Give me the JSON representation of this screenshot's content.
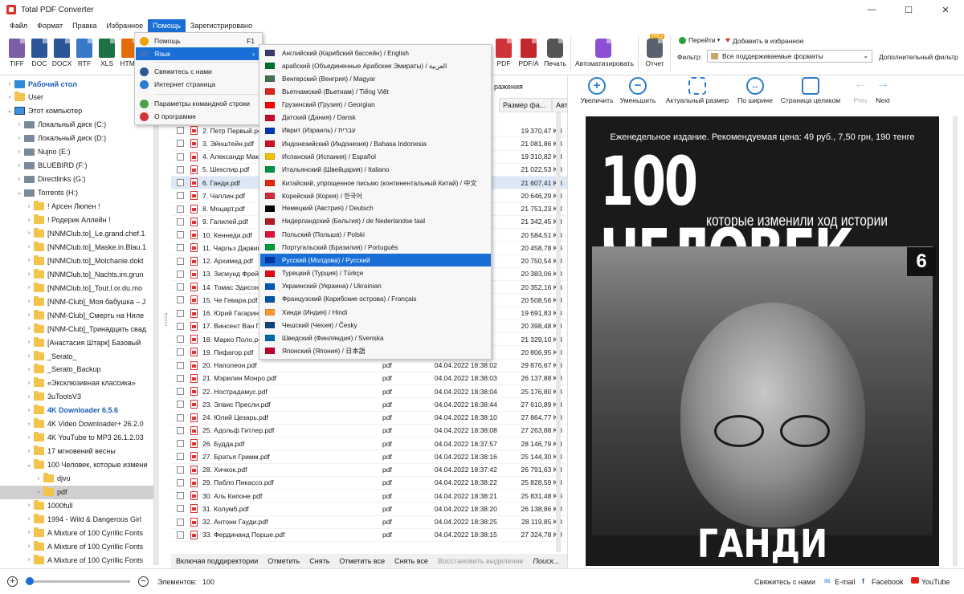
{
  "window": {
    "title": "Total PDF Converter"
  },
  "menu": [
    "Файл",
    "Формат",
    "Правка",
    "Избранное",
    "Помощь",
    "Зарегистрировано"
  ],
  "toolbar": {
    "formats": [
      {
        "label": "TIFF",
        "color": "#7b5ea7"
      },
      {
        "label": "DOC",
        "color": "#2b5797"
      },
      {
        "label": "DOCX",
        "color": "#2b5797"
      },
      {
        "label": "RTF",
        "color": "#3a79c8"
      },
      {
        "label": "XLS",
        "color": "#1e7145"
      },
      {
        "label": "HTML",
        "color": "#e36c09"
      },
      {
        "label": "PDF",
        "color": "#d13438"
      },
      {
        "label": "PDF/A",
        "color": "#c1272d"
      }
    ],
    "print": "Печать",
    "automate": "Автоматизировать",
    "report": "Отчет",
    "pro_badge": "PRO",
    "goto": "Перейти",
    "add_fav": "Добавить в избранное",
    "filter_label": "Фильтр:",
    "filter_value": "Все поддерживаемые форматы",
    "advanced_filter": "Дополнительный фильтр"
  },
  "help_menu": [
    {
      "label": "Помощь",
      "shortcut": "F1",
      "icon": "help-icon",
      "color": "#f0a30a"
    },
    {
      "label": "Язык",
      "icon": "language-flag-icon",
      "color": "#3a6fc4"
    },
    {
      "label": "Свяжитесь с нами",
      "icon": "contact-icon",
      "color": "#2b5797"
    },
    {
      "label": "Интернет страница",
      "icon": "web-icon",
      "color": "#2b7bd0"
    },
    {
      "label": "Параметры командной строки",
      "icon": "command-line-icon",
      "color": "#4aa34a"
    },
    {
      "label": "О программе",
      "icon": "about-icon",
      "color": "#d13438"
    }
  ],
  "languages": [
    {
      "label": "Английский (Карибский бассейн) / English",
      "flag": "#3c3b6e"
    },
    {
      "label": "арабский (Объединенные Арабские Эмираты) / العربية",
      "flag": "#00732f"
    },
    {
      "label": "Венгерский (Венгрия) / Magyar",
      "flag": "#477050"
    },
    {
      "label": "Вьетнамский (Вьетнам) / Tiếng Việt",
      "flag": "#da251d"
    },
    {
      "label": "Грузинский (Грузия) / Georgian",
      "flag": "#ff0000"
    },
    {
      "label": "Датский (Дания) / Dansk",
      "flag": "#c60c30"
    },
    {
      "label": "Иврит (Израиль) / עברית",
      "flag": "#0038b8"
    },
    {
      "label": "Индонезийский (Индонезия) / Bahasa Indonesia",
      "flag": "#ce1126"
    },
    {
      "label": "Испанский (Испания) / Español",
      "flag": "#f1bf00"
    },
    {
      "label": "Итальянский (Швейцария) / Italiano",
      "flag": "#009246"
    },
    {
      "label": "Китайский, упрощенное письмо (континентальный Китай) / 中文",
      "flag": "#de2910"
    },
    {
      "label": "Корейский (Корея) / 한국어",
      "flag": "#cd2e3a"
    },
    {
      "label": "Немецкий (Австрия) / Deutsch",
      "flag": "#000000"
    },
    {
      "label": "Нидерландский (Бельгия) / de Nederlandse taal",
      "flag": "#ae1c28"
    },
    {
      "label": "Польский (Польша) / Polski",
      "flag": "#dc143c"
    },
    {
      "label": "Португальский (Бразилия) / Português",
      "flag": "#009c3b"
    },
    {
      "label": "Русский (Молдова) / Русский",
      "flag": "#0039a6"
    },
    {
      "label": "Турецкий (Турция) / Türkçe",
      "flag": "#e30a17"
    },
    {
      "label": "Украинский (Украина) / Ukrainian",
      "flag": "#0057b7"
    },
    {
      "label": "Французский (Карибские острова) / Français",
      "flag": "#0055a4"
    },
    {
      "label": "Хинди (Индия) / Hindi",
      "flag": "#ff9933"
    },
    {
      "label": "Чешский (Чехия) / Česky",
      "flag": "#11457e"
    },
    {
      "label": "Шведский (Финляндия) / Svenska",
      "flag": "#006aa7"
    },
    {
      "label": "Японский (Япония) / 日本語",
      "flag": "#bc002d"
    }
  ],
  "selected_language_index": 16,
  "tree": [
    {
      "label": "Рабочий стол",
      "icon": "desktop",
      "indent": 0,
      "arrow": "›",
      "bold": true
    },
    {
      "label": "User",
      "icon": "folder",
      "indent": 0,
      "arrow": "›"
    },
    {
      "label": "Этот компьютер",
      "icon": "pc",
      "indent": 0,
      "arrow": "⌄"
    },
    {
      "label": "Локальный диск (C:)",
      "icon": "drive",
      "indent": 1,
      "arrow": "›"
    },
    {
      "label": "Локальный диск (D:)",
      "icon": "drive",
      "indent": 1,
      "arrow": "›"
    },
    {
      "label": "Nujno (E:)",
      "icon": "drive",
      "indent": 1,
      "arrow": "›"
    },
    {
      "label": "BLUEBIRD (F:)",
      "icon": "drive",
      "indent": 1,
      "arrow": "›"
    },
    {
      "label": "Directlinks (G:)",
      "icon": "drive",
      "indent": 1,
      "arrow": "›"
    },
    {
      "label": "Torrents (H:)",
      "icon": "drive",
      "indent": 1,
      "arrow": "⌄"
    },
    {
      "label": "! Арсен Люпен !",
      "icon": "folder",
      "indent": 2,
      "arrow": "›"
    },
    {
      "label": "! Родерик Аллейн !",
      "icon": "folder",
      "indent": 2,
      "arrow": "›"
    },
    {
      "label": "[NNMClub.to]_Le.grand.chef.1",
      "icon": "folder",
      "indent": 2,
      "arrow": "›"
    },
    {
      "label": "[NNMClub.to]_Maske.in.Blau.1",
      "icon": "folder",
      "indent": 2,
      "arrow": "›"
    },
    {
      "label": "[NNMClub.to]_Molchanie.dokt",
      "icon": "folder",
      "indent": 2,
      "arrow": "›"
    },
    {
      "label": "[NNMClub.to]_Nachts.im.grun",
      "icon": "folder",
      "indent": 2,
      "arrow": "›"
    },
    {
      "label": "[NNMClub.to]_Tout.l.or.du.mo",
      "icon": "folder",
      "indent": 2,
      "arrow": "›"
    },
    {
      "label": "[NNM-Club]_Моя бабушка – J",
      "icon": "folder",
      "indent": 2,
      "arrow": "›"
    },
    {
      "label": "[NNM-Club]_Смерть на Ниле",
      "icon": "folder",
      "indent": 2,
      "arrow": "›"
    },
    {
      "label": "[NNM-Club]_Тринадцать свад",
      "icon": "folder",
      "indent": 2,
      "arrow": "›"
    },
    {
      "label": "[Анастасия Штарк] Базовый",
      "icon": "folder",
      "indent": 2,
      "arrow": "›"
    },
    {
      "label": "_Serato_",
      "icon": "folder",
      "indent": 2,
      "arrow": "›"
    },
    {
      "label": "_Serato_Backup",
      "icon": "folder",
      "indent": 2,
      "arrow": "›"
    },
    {
      "label": "«Эксклюзивная классика»",
      "icon": "folder",
      "indent": 2,
      "arrow": "›"
    },
    {
      "label": "3uToolsV3",
      "icon": "folder",
      "indent": 2,
      "arrow": "›"
    },
    {
      "label": "4K Downloader 6.5.6",
      "icon": "folder",
      "indent": 2,
      "arrow": "›",
      "bold": true
    },
    {
      "label": "4K Video Downloader+ 26.2.0",
      "icon": "folder",
      "indent": 2,
      "arrow": "›"
    },
    {
      "label": "4K YouTube to MP3 26.1.2.03",
      "icon": "folder",
      "indent": 2,
      "arrow": "›"
    },
    {
      "label": "17 мгновений весны",
      "icon": "folder",
      "indent": 2,
      "arrow": "›"
    },
    {
      "label": "100 Человек, которые измени",
      "icon": "folder",
      "indent": 2,
      "arrow": "⌄"
    },
    {
      "label": "djvu",
      "icon": "folder",
      "indent": 3,
      "arrow": "›"
    },
    {
      "label": "pdf",
      "icon": "folder",
      "indent": 3,
      "arrow": "›",
      "selected": true
    },
    {
      "label": "1000full",
      "icon": "folder",
      "indent": 2,
      "arrow": "›"
    },
    {
      "label": "1994 - Wild & Dangerous Girl",
      "icon": "folder",
      "indent": 2,
      "arrow": "›"
    },
    {
      "label": "A Mixture of 100 Cyrillic Fonts",
      "icon": "folder",
      "indent": 2,
      "arrow": "›"
    },
    {
      "label": "A Mixture of 100 Cyrillic Fonts",
      "icon": "folder",
      "indent": 2,
      "arrow": "›"
    },
    {
      "label": "A Mixture of 100 Cyrillic Fonts",
      "icon": "folder",
      "indent": 2,
      "arrow": "›"
    }
  ],
  "filelist": {
    "header_tab_partial": "ражения",
    "columns": {
      "size": "Размер фа...",
      "author": "Авт"
    },
    "rows": [
      {
        "name": "2. Петр Первый.pdf",
        "type": "",
        "date": "",
        "size": "19 370,47 KB"
      },
      {
        "name": "3. Эйнштейн.pdf",
        "type": "",
        "date": "",
        "size": "21 081,86 KB"
      },
      {
        "name": "4. Александр Маке",
        "type": "",
        "date": "",
        "size": "19 310,82 KB"
      },
      {
        "name": "5. Шекспир.pdf",
        "type": "",
        "date": "",
        "size": "21 022,53 KB"
      },
      {
        "name": "6. Ганди.pdf",
        "type": "",
        "date": "",
        "size": "21 607,41 KB",
        "selected": true
      },
      {
        "name": "7. Чаплин.pdf",
        "type": "",
        "date": "",
        "size": "20 646,29 KB"
      },
      {
        "name": "8. Моцарт.pdf",
        "type": "",
        "date": "",
        "size": "21 751,23 KB"
      },
      {
        "name": "9. Галилей.pdf",
        "type": "",
        "date": "",
        "size": "21 342,45 KB"
      },
      {
        "name": "10. Кеннеди.pdf",
        "type": "",
        "date": "",
        "size": "20 584,51 KB"
      },
      {
        "name": "11. Чарльз Дарвин",
        "type": "",
        "date": "",
        "size": "20 458,78 KB"
      },
      {
        "name": "12. Архимед.pdf",
        "type": "",
        "date": "",
        "size": "20 750,54 KB"
      },
      {
        "name": "13. Зигмунд Фрейд",
        "type": "",
        "date": "",
        "size": "20 383,06 KB"
      },
      {
        "name": "14. Томас Эдисон.p",
        "type": "",
        "date": "",
        "size": "20 352,16 KB"
      },
      {
        "name": "15. Че Гевара.pdf",
        "type": "",
        "date": "",
        "size": "20 508,56 KB"
      },
      {
        "name": "16. Юрий Гагарин.",
        "type": "",
        "date": "",
        "size": "19 691,83 KB"
      },
      {
        "name": "17. Винсент Ван Го",
        "type": "",
        "date": "",
        "size": "20 398,48 KB"
      },
      {
        "name": "18. Марко Поло.pdf",
        "type": "",
        "date": "",
        "size": "21 329,10 KB"
      },
      {
        "name": "19. Пифагор.pdf",
        "type": "",
        "date": "",
        "size": "20 806,95 KB"
      },
      {
        "name": "20. Наполеон.pdf",
        "type": "pdf",
        "date": "04.04.2022 18:38:02",
        "size": "29 876,67 KB"
      },
      {
        "name": "21. Мэрилин Монро.pdf",
        "type": "pdf",
        "date": "04.04.2022 18:38:03",
        "size": "26 137,88 KB"
      },
      {
        "name": "22. Нострадамус.pdf",
        "type": "pdf",
        "date": "04.04.2022 18:38:04",
        "size": "25 176,80 KB"
      },
      {
        "name": "23. Элвис Пресли.pdf",
        "type": "pdf",
        "date": "04.04.2022 18:38:44",
        "size": "27 610,89 KB"
      },
      {
        "name": "24. Юлий Цезарь.pdf",
        "type": "pdf",
        "date": "04.04.2022 18:38:10",
        "size": "27 864,77 KB"
      },
      {
        "name": "25. Адольф Гитлер.pdf",
        "type": "pdf",
        "date": "04.04.2022 18:38:08",
        "size": "27 263,88 KB"
      },
      {
        "name": "26. Будда.pdf",
        "type": "pdf",
        "date": "04.04.2022 18:37:57",
        "size": "28 146,79 KB"
      },
      {
        "name": "27. Братья Гримм.pdf",
        "type": "pdf",
        "date": "04.04.2022 18:38:16",
        "size": "25 144,30 KB"
      },
      {
        "name": "28. Хичкок.pdf",
        "type": "pdf",
        "date": "04.04.2022 18:37:42",
        "size": "26 791,63 KB"
      },
      {
        "name": "29. Пабло Пикассо.pdf",
        "type": "pdf",
        "date": "04.04.2022 18:38:22",
        "size": "25 828,59 KB"
      },
      {
        "name": "30. Аль Капоне.pdf",
        "type": "pdf",
        "date": "04.04.2022 18:38:21",
        "size": "25 831,48 KB"
      },
      {
        "name": "31. Колумб.pdf",
        "type": "pdf",
        "date": "04.04.2022 18:38:20",
        "size": "26 138,86 KB"
      },
      {
        "name": "32. Антони Гауди.pdf",
        "type": "pdf",
        "date": "04.04.2022 18:38:25",
        "size": "28 119,85 KB"
      },
      {
        "name": "33. Фердинанд Порше.pdf",
        "type": "pdf",
        "date": "04.04.2022 18:38:15",
        "size": "27 324,78 KB"
      }
    ]
  },
  "bottom_actions": [
    "Включая поддиректории",
    "Отметить",
    "Снять",
    "Отметить все",
    "Снять все",
    "Восстановить выделение",
    "Поиск..."
  ],
  "preview": {
    "buttons": [
      "Увеличить",
      "Уменьшить",
      "Актуальный размер",
      "По ширине",
      "Страница целиком",
      "Prev",
      "Next"
    ],
    "magazine": {
      "top_line": "Еженедельное издание. Рекомендуемая цена: 49 руб., 7,50 грн, 190 тенге",
      "title": "100 ЧЕЛОВЕК,",
      "subtitle": "которые изменили ход истории",
      "issue": "6",
      "name": "ГАНДИ"
    }
  },
  "status": {
    "elements_label": "Элементов:",
    "elements_count": "100",
    "contact": "Свяжитесь с нами",
    "email": "E-mail",
    "facebook": "Facebook",
    "youtube": "YouTube"
  }
}
